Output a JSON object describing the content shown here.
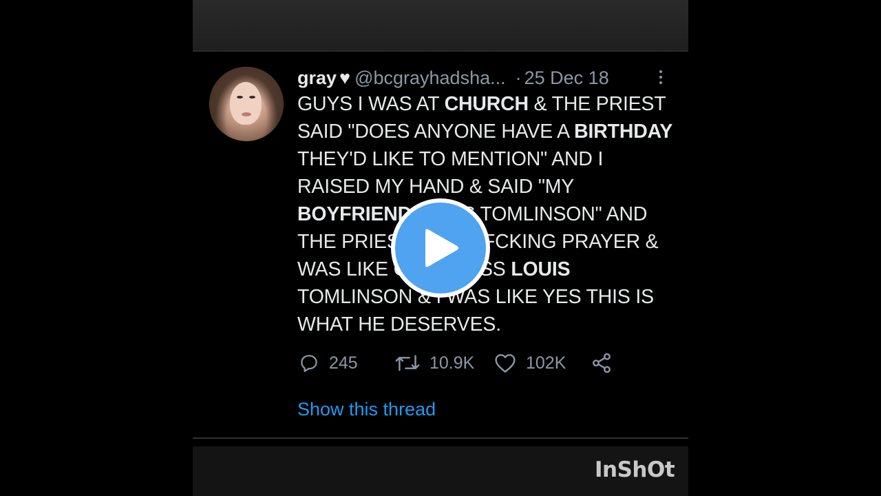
{
  "tweet": {
    "display_name": "gray",
    "name_emoji": "♥",
    "handle": "@bcgrayhadsha...",
    "separator": "·",
    "date": "25 Dec 18",
    "text_segments": [
      {
        "text": "GUYS I WAS AT ",
        "bold": false
      },
      {
        "text": "CHURCH",
        "bold": true
      },
      {
        "text": " & THE PRIEST SAID \"DOES ANYONE HAVE A ",
        "bold": false
      },
      {
        "text": "BIRTHDAY",
        "bold": true
      },
      {
        "text": " THEY'D LIKE TO MENTION\" AND I RAISED MY HAND & SAID \"MY ",
        "bold": false
      },
      {
        "text": "BOYFRIEND",
        "bold": true
      },
      {
        "text": " LOUIS TOMLINSON\" AND THE PRIEST SAID A FCKING PRAYER & WAS LIKE GOD BLESS ",
        "bold": false
      },
      {
        "text": "LOUIS",
        "bold": true
      },
      {
        "text": " TOMLINSON & I WAS LIKE YES THIS IS WHAT HE DESERVES.",
        "bold": false
      }
    ],
    "actions": {
      "replies": "245",
      "retweets": "10.9K",
      "likes": "102K"
    },
    "thread_link": "Show this thread"
  },
  "overlay": {
    "watermark": "InShOt",
    "play_color": "#4fa3f0"
  },
  "colors": {
    "text": "#e7e9ea",
    "muted": "#8b98a5",
    "link": "#1d9bf0",
    "background": "#000000"
  }
}
